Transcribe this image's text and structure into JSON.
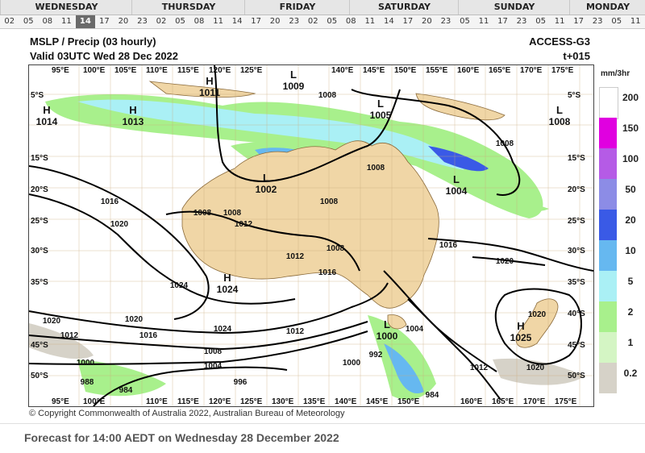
{
  "days": [
    "WEDNESDAY",
    "THURSDAY",
    "FRIDAY",
    "SATURDAY",
    "SUNDAY",
    "MONDAY"
  ],
  "hours": [
    "02",
    "05",
    "08",
    "11",
    "14",
    "17",
    "20",
    "23",
    "02",
    "05",
    "08",
    "11",
    "14",
    "17",
    "20",
    "23",
    "02",
    "05",
    "08",
    "11",
    "14",
    "17",
    "20",
    "23",
    "05",
    "11",
    "17",
    "23",
    "05",
    "11",
    "17",
    "23",
    "05",
    "11"
  ],
  "selected_hour_index": 4,
  "header": {
    "title": "MSLP / Precip  (03 hourly)",
    "valid": "Valid 03UTC Wed 28 Dec 2022",
    "model": "ACCESS-G3",
    "step": "t+015"
  },
  "legend": {
    "unit": "mm/3hr",
    "levels": [
      {
        "label": "200",
        "color": "#ffffff"
      },
      {
        "label": "150",
        "color": "#e000e0"
      },
      {
        "label": "100",
        "color": "#b55be6"
      },
      {
        "label": "50",
        "color": "#8c8ce6"
      },
      {
        "label": "20",
        "color": "#3a5ae6"
      },
      {
        "label": "10",
        "color": "#66b8f0"
      },
      {
        "label": "5",
        "color": "#aaf0f5"
      },
      {
        "label": "2",
        "color": "#a8f08c"
      },
      {
        "label": "1",
        "color": "#d4f5c4"
      },
      {
        "label": "0.2",
        "color": "#d6d2c8"
      }
    ]
  },
  "map": {
    "lon_labels_top": [
      "95°E",
      "100°E",
      "105°E",
      "110°E",
      "115°E",
      "120°E",
      "125°E",
      "140°E",
      "145°E",
      "150°E",
      "155°E",
      "160°E",
      "165°E",
      "170°E",
      "175°E"
    ],
    "lon_labels_bottom": [
      "95°E",
      "100°E",
      "110°E",
      "115°E",
      "120°E",
      "125°E",
      "130°E",
      "135°E",
      "140°E",
      "145°E",
      "150°E",
      "160°E",
      "165°E",
      "170°E",
      "175°E"
    ],
    "lat_labels_left": [
      "5°S",
      "15°S",
      "20°S",
      "25°S",
      "30°S",
      "35°S",
      "45°S",
      "50°S"
    ],
    "lat_labels_right": [
      "5°S",
      "15°S",
      "20°S",
      "25°S",
      "30°S",
      "35°S",
      "40°S",
      "45°S",
      "50°S"
    ],
    "systems": [
      {
        "letter": "H",
        "value": "1014"
      },
      {
        "letter": "H",
        "value": "1013"
      },
      {
        "letter": "H",
        "value": "1011"
      },
      {
        "letter": "L",
        "value": "1009"
      },
      {
        "letter": "L",
        "value": "1005"
      },
      {
        "letter": "L",
        "value": "1008"
      },
      {
        "letter": "L",
        "value": "1002"
      },
      {
        "letter": "L",
        "value": "1004"
      },
      {
        "letter": "H",
        "value": "1024"
      },
      {
        "letter": "L",
        "value": "1000"
      },
      {
        "letter": "H",
        "value": "1025"
      }
    ],
    "isobar_labels": [
      "1008",
      "1008",
      "1008",
      "1008",
      "1016",
      "1020",
      "1024",
      "1008",
      "1012",
      "1008",
      "1016",
      "1012",
      "1016",
      "1020",
      "1024",
      "1020",
      "1020",
      "1012",
      "1016",
      "1012",
      "1008",
      "1004",
      "1000",
      "988",
      "984",
      "996",
      "1000",
      "992",
      "984",
      "1004",
      "1012",
      "1020",
      "1020",
      "1008"
    ]
  },
  "copyright": "© Copyright Commonwealth of Australia 2022, Australian Bureau of Meteorology",
  "forecast": "Forecast for 14:00 AEDT on Wednesday 28 December 2022"
}
